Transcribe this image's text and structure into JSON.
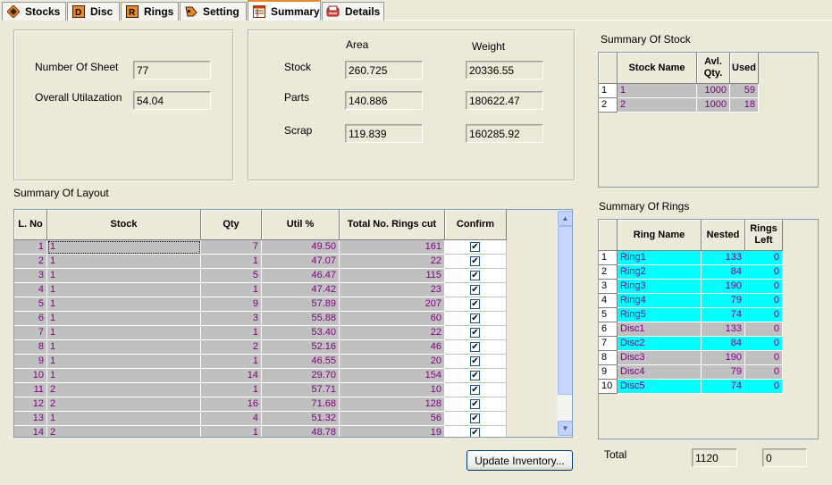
{
  "tabs": [
    {
      "label": "Stocks",
      "icon": "stocks-icon"
    },
    {
      "label": "Disc",
      "icon": "disc-icon"
    },
    {
      "label": "Rings",
      "icon": "rings-icon"
    },
    {
      "label": "Setting",
      "icon": "setting-icon"
    },
    {
      "label": "Summary",
      "icon": "summary-icon"
    },
    {
      "label": "Details",
      "icon": "details-icon"
    }
  ],
  "general": {
    "sheets_label": "Number Of Sheet",
    "sheets_value": "77",
    "util_label": "Overall Utilazation",
    "util_value": "54.04"
  },
  "amounts": {
    "area_header": "Area",
    "weight_header": "Weight",
    "rows": [
      {
        "label": "Stock",
        "area": "260.725",
        "weight": "20336.55"
      },
      {
        "label": "Parts",
        "area": "140.886",
        "weight": "180622.47"
      },
      {
        "label": "Scrap",
        "area": "119.839",
        "weight": "160285.92"
      }
    ]
  },
  "layout": {
    "title": "Summary Of Layout",
    "headers": [
      "L. No",
      "Stock",
      "Qty",
      "Util %",
      "Total No. Rings cut",
      "Confirm"
    ],
    "rows": [
      {
        "no": "1",
        "stock": "1",
        "qty": "7",
        "util": "49.50",
        "rings": "161",
        "confirm": true
      },
      {
        "no": "2",
        "stock": "1",
        "qty": "1",
        "util": "47.07",
        "rings": "22",
        "confirm": true
      },
      {
        "no": "3",
        "stock": "1",
        "qty": "5",
        "util": "46.47",
        "rings": "115",
        "confirm": true
      },
      {
        "no": "4",
        "stock": "1",
        "qty": "1",
        "util": "47.42",
        "rings": "23",
        "confirm": true
      },
      {
        "no": "5",
        "stock": "1",
        "qty": "9",
        "util": "57.89",
        "rings": "207",
        "confirm": true
      },
      {
        "no": "6",
        "stock": "1",
        "qty": "3",
        "util": "55.88",
        "rings": "60",
        "confirm": true
      },
      {
        "no": "7",
        "stock": "1",
        "qty": "1",
        "util": "53.40",
        "rings": "22",
        "confirm": true
      },
      {
        "no": "8",
        "stock": "1",
        "qty": "2",
        "util": "52.16",
        "rings": "46",
        "confirm": true
      },
      {
        "no": "9",
        "stock": "1",
        "qty": "1",
        "util": "46.55",
        "rings": "20",
        "confirm": true
      },
      {
        "no": "10",
        "stock": "1",
        "qty": "14",
        "util": "29.70",
        "rings": "154",
        "confirm": true
      },
      {
        "no": "11",
        "stock": "2",
        "qty": "1",
        "util": "57.71",
        "rings": "10",
        "confirm": true
      },
      {
        "no": "12",
        "stock": "2",
        "qty": "16",
        "util": "71.68",
        "rings": "128",
        "confirm": true
      },
      {
        "no": "13",
        "stock": "1",
        "qty": "4",
        "util": "51.32",
        "rings": "56",
        "confirm": true
      },
      {
        "no": "14",
        "stock": "2",
        "qty": "1",
        "util": "48.78",
        "rings": "19",
        "confirm": true
      }
    ]
  },
  "stock_summary": {
    "title": "Summary Of Stock",
    "headers": [
      "Stock Name",
      "Avl. Qty.",
      "Used"
    ],
    "rows": [
      {
        "no": "1",
        "name": "1",
        "avl": "1000",
        "used": "59"
      },
      {
        "no": "2",
        "name": "2",
        "avl": "1000",
        "used": "18"
      }
    ]
  },
  "rings_summary": {
    "title": "Summary Of Rings",
    "headers": [
      "Ring Name",
      "Nested",
      "Rings Left"
    ],
    "rows": [
      {
        "no": "1",
        "name": "Ring1",
        "nested": "133",
        "left": "0"
      },
      {
        "no": "2",
        "name": "Ring2",
        "nested": "84",
        "left": "0"
      },
      {
        "no": "3",
        "name": "Ring3",
        "nested": "190",
        "left": "0"
      },
      {
        "no": "4",
        "name": "Ring4",
        "nested": "79",
        "left": "0"
      },
      {
        "no": "5",
        "name": "Ring5",
        "nested": "74",
        "left": "0"
      },
      {
        "no": "6",
        "name": "Disc1",
        "nested": "133",
        "left": "0"
      },
      {
        "no": "7",
        "name": "Disc2",
        "nested": "84",
        "left": "0"
      },
      {
        "no": "8",
        "name": "Disc3",
        "nested": "190",
        "left": "0"
      },
      {
        "no": "9",
        "name": "Disc4",
        "nested": "79",
        "left": "0"
      },
      {
        "no": "10",
        "name": "Disc5",
        "nested": "74",
        "left": "0"
      }
    ]
  },
  "totals": {
    "label": "Total",
    "nested": "1120",
    "left": "0"
  },
  "update_button": "Update Inventory...",
  "colors": {
    "highlight": "#00ffff",
    "grey_row": "#c0c0c0",
    "value_text": "#800080",
    "active_tab_accent": "#e68b2c"
  }
}
